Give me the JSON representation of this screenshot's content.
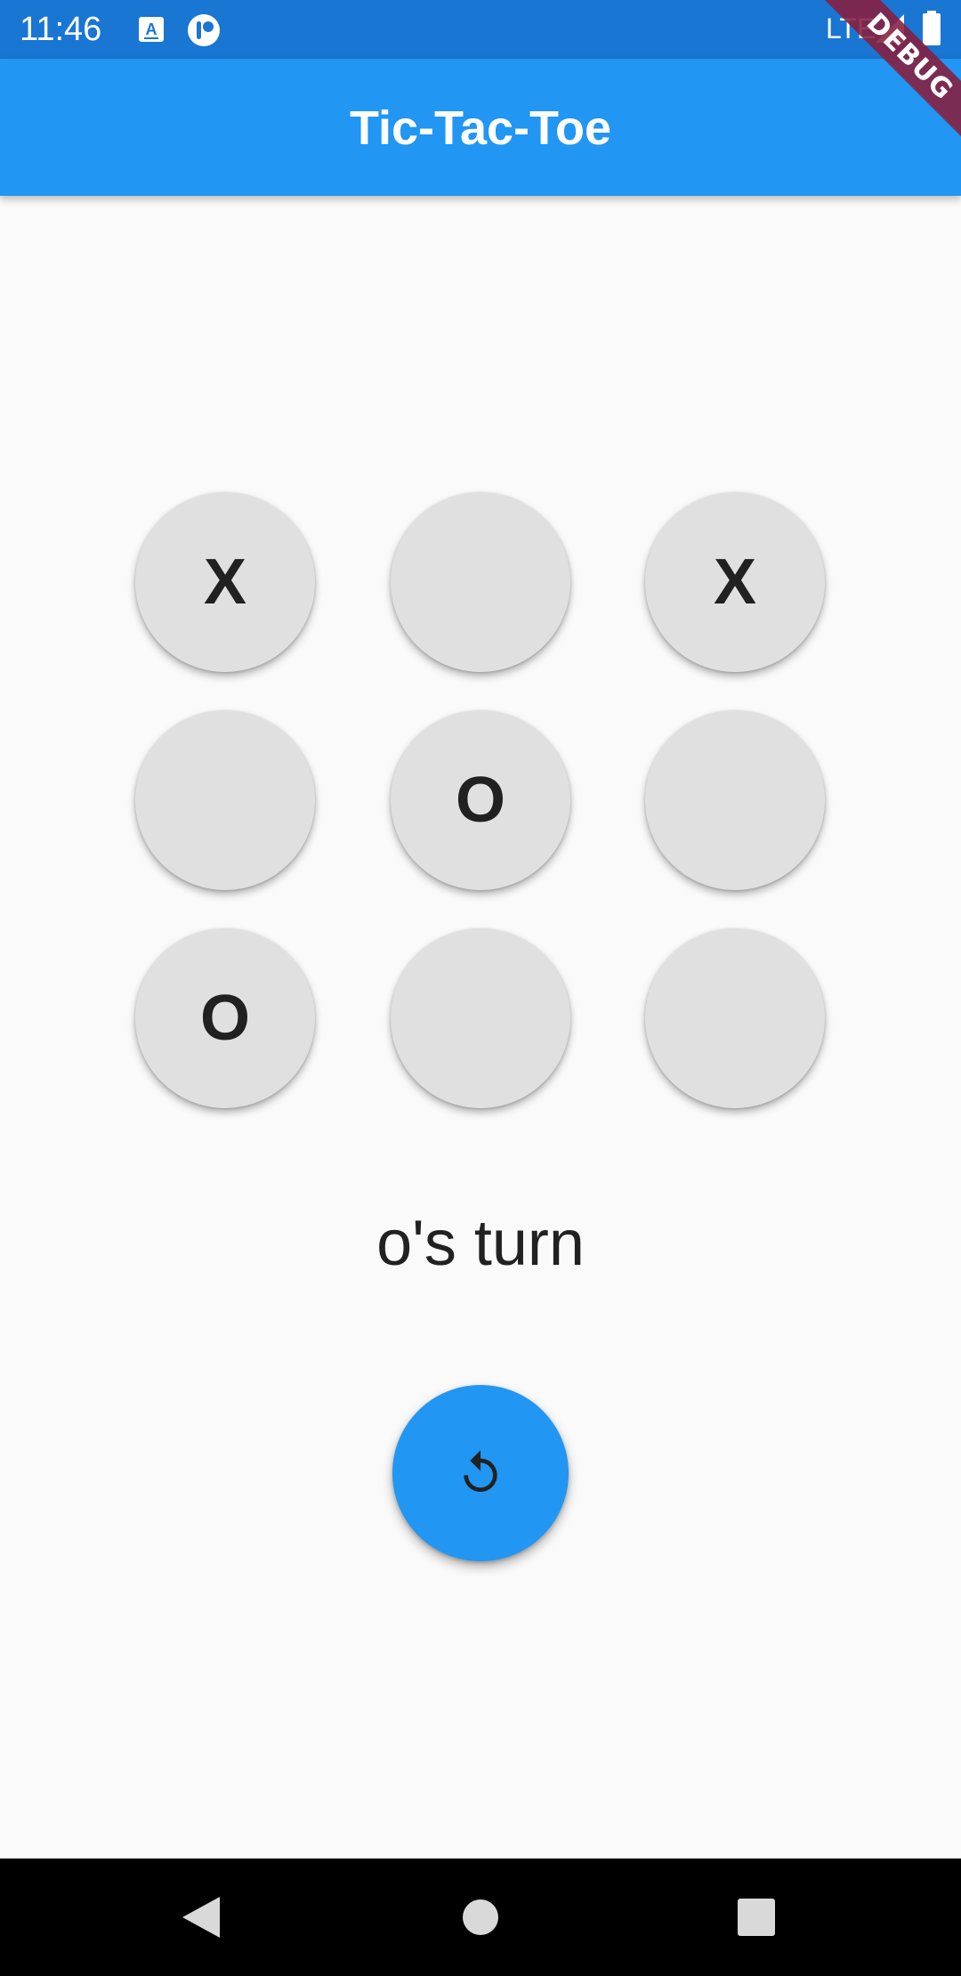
{
  "status_bar": {
    "time": "11:46",
    "network": "LTE",
    "icons": [
      "translate-icon",
      "app-notification-icon",
      "signal-icon",
      "battery-icon"
    ]
  },
  "app_bar": {
    "title": "Tic-Tac-Toe"
  },
  "debug_banner": {
    "label": "DEBUG"
  },
  "board": {
    "cells": [
      "X",
      "",
      "X",
      "",
      "O",
      "",
      "O",
      "",
      ""
    ]
  },
  "status": {
    "turn_text": "o's turn"
  },
  "reset_button": {
    "icon": "refresh-icon"
  },
  "nav_bar": {
    "buttons": [
      "back-icon",
      "home-icon",
      "recents-icon"
    ]
  },
  "colors": {
    "status_bar": "#1976d2",
    "app_bar": "#2196f3",
    "cell": "#e0e0e0",
    "fab": "#2196f3",
    "background": "#fafafa"
  }
}
